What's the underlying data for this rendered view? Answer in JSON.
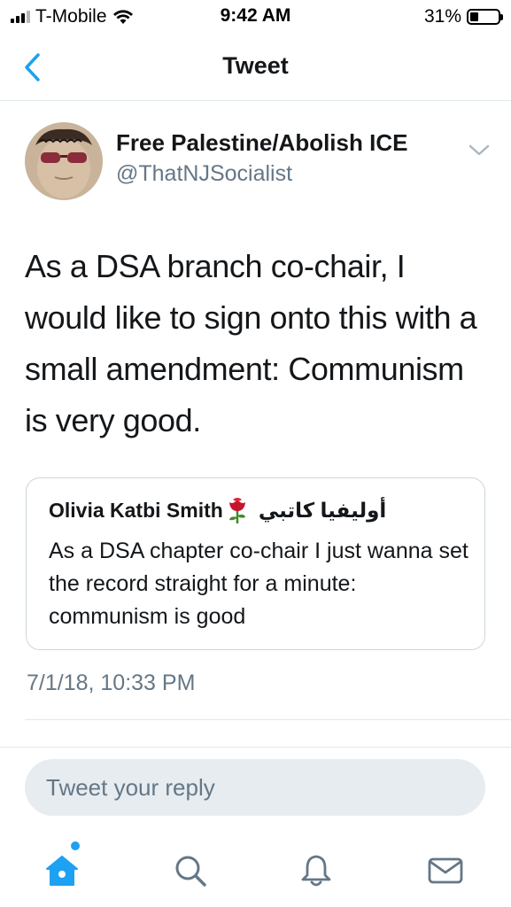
{
  "status_bar": {
    "carrier": "T-Mobile",
    "time": "9:42 AM",
    "battery": "31%",
    "battery_level": 0.31
  },
  "nav": {
    "title": "Tweet",
    "back_icon": "chevron-left-icon"
  },
  "tweet": {
    "author_name": "Free Palestine/Abolish ICE",
    "author_handle": "@ThatNJSocialist",
    "text": "As a DSA branch co-chair, I would like to sign onto this with a small amendment: Communism is very good.",
    "timestamp": "7/1/18, 10:33 PM",
    "quote": {
      "author_name": "Olivia Katbi Smith",
      "author_name_arabic": "أوليفيا كاتبي",
      "emoji": "🌹",
      "text": "As a DSA chapter co-chair I just wanna set the record straight for a minute: communism is good"
    }
  },
  "reply": {
    "placeholder": "Tweet your reply"
  },
  "tabs": [
    {
      "name": "home",
      "icon": "home-icon",
      "active": true
    },
    {
      "name": "search",
      "icon": "search-icon",
      "active": false
    },
    {
      "name": "notifications",
      "icon": "bell-icon",
      "active": false
    },
    {
      "name": "messages",
      "icon": "mail-icon",
      "active": false
    }
  ],
  "colors": {
    "accent": "#1da1f2",
    "text_primary": "#14171a",
    "text_secondary": "#657786",
    "divider": "#e1e8ed"
  }
}
